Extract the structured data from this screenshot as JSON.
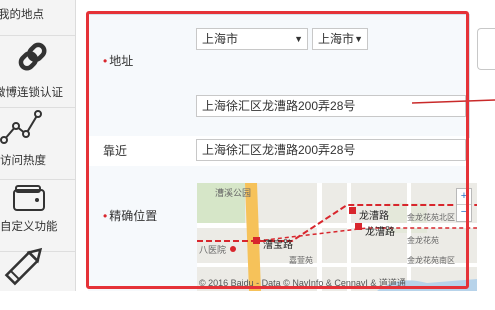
{
  "sidebar": {
    "items": [
      {
        "label": "我的地点",
        "icon": "location-icon"
      },
      {
        "label": "微博连锁认证",
        "icon": "link-icon"
      },
      {
        "label": "访问热度",
        "icon": "trend-chart-icon"
      },
      {
        "label": "自定义功能",
        "icon": "wallet-icon"
      },
      {
        "label": "",
        "icon": "pencil-icon"
      }
    ]
  },
  "form": {
    "address_label": "地址",
    "province_value": "上海市",
    "city_value": "上海市",
    "address_value": "上海徐汇区龙漕路200弄28号",
    "nearby_label": "靠近",
    "nearby_value": "上海徐汇区龙漕路200弄28号",
    "location_label": "精确位置",
    "required_mark": "•"
  },
  "map": {
    "labels": {
      "area1": "漕溪公园",
      "station1": "龙漕路",
      "station2": "龙漕路",
      "station3": "漕宝路",
      "park": "金龙花苑北区",
      "park2": "金龙花苑",
      "hospital": "八医院",
      "garden": "嘉萱苑",
      "garden2": "金龙花苑南区",
      "copyright": "© 2016 Baidu - Data © NavInfo & CennavI & 道道通"
    },
    "zoom_in": "+",
    "zoom_out": "−"
  },
  "colors": {
    "highlight_border": "#e53238",
    "required": "#d9272e",
    "metro_red": "#d8262d",
    "road_yellow": "#f6c25a"
  }
}
